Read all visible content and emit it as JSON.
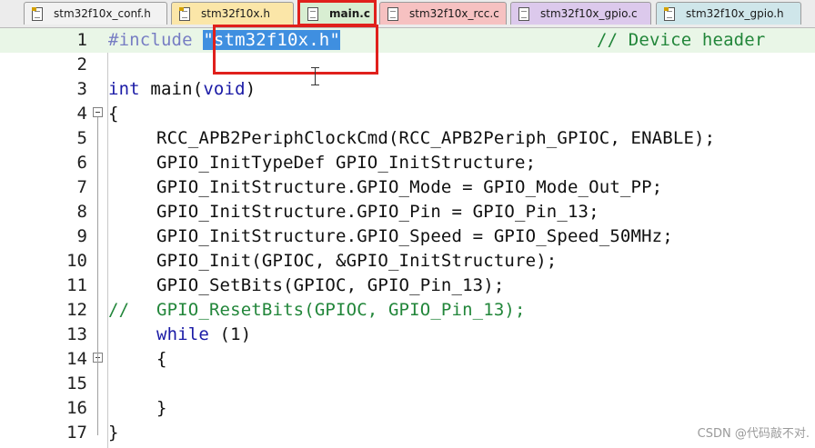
{
  "tabs": [
    {
      "label": "stm32f10x_conf.h",
      "type": "h",
      "color": "#f2f2f2"
    },
    {
      "label": "stm32f10x.h",
      "type": "h",
      "color": "#fbe6a8"
    },
    {
      "label": "main.c",
      "type": "c",
      "color": "#d8eed2",
      "active": true
    },
    {
      "label": "stm32f10x_rcc.c",
      "type": "c",
      "color": "#f6c1c1"
    },
    {
      "label": "stm32f10x_gpio.c",
      "type": "c",
      "color": "#dcc9ec"
    },
    {
      "label": "stm32f10x_gpio.h",
      "type": "h",
      "color": "#cfe6ea"
    }
  ],
  "editor": {
    "line_numbers": [
      "1",
      "2",
      "3",
      "4",
      "5",
      "6",
      "7",
      "8",
      "9",
      "10",
      "11",
      "12",
      "13",
      "14",
      "15",
      "16",
      "17"
    ],
    "lines": {
      "l1_directive": "#include",
      "l1_string": "\"stm32f10x.h\"",
      "l1_comment": "// Device header",
      "l3_type": "int",
      "l3_name": "main(",
      "l3_void": "void",
      "l3_close": ")",
      "l4": "{",
      "l5": "RCC_APB2PeriphClockCmd(RCC_APB2Periph_GPIOC, ENABLE);",
      "l6": "GPIO_InitTypeDef GPIO_InitStructure;",
      "l7": "GPIO_InitStructure.GPIO_Mode = GPIO_Mode_Out_PP;",
      "l8": "GPIO_InitStructure.GPIO_Pin = GPIO_Pin_13;",
      "l9": "GPIO_InitStructure.GPIO_Speed = GPIO_Speed_50MHz;",
      "l10": "GPIO_Init(GPIOC, &GPIO_InitStructure);",
      "l11": "GPIO_SetBits(GPIOC, GPIO_Pin_13);",
      "l12_marker": "//",
      "l12_code": "GPIO_ResetBits(GPIOC, GPIO_Pin_13);",
      "l13_kw": "while",
      "l13_rest": " (1)",
      "l14": "{",
      "l16": "}",
      "l17": "}"
    }
  },
  "watermark": "CSDN @代码敲不对."
}
